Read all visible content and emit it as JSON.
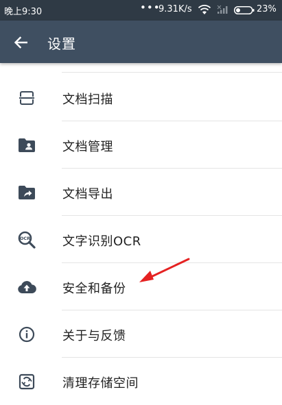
{
  "status_bar": {
    "time": "晚上9:30",
    "dots": "•••",
    "network_speed": "9.31K/s",
    "battery_percent": "23%"
  },
  "app_bar": {
    "back_icon": "arrow-left-icon",
    "title": "设置"
  },
  "settings": {
    "items": [
      {
        "label": "文档扫描",
        "icon": "scan-icon"
      },
      {
        "label": "文档管理",
        "icon": "folder-user-icon"
      },
      {
        "label": "文档导出",
        "icon": "folder-export-icon"
      },
      {
        "label": "文字识别OCR",
        "icon": "ocr-search-icon"
      },
      {
        "label": "安全和备份",
        "icon": "cloud-upload-icon"
      },
      {
        "label": "关于与反馈",
        "icon": "info-icon"
      },
      {
        "label": "清理存储空间",
        "icon": "clean-storage-icon"
      }
    ]
  },
  "annotation": {
    "type": "red-arrow",
    "points_to": "安全和备份"
  },
  "colors": {
    "status_bar": "#2f3a45",
    "app_bar": "#3f4f61",
    "icon": "#3d4a59",
    "text": "#222222",
    "divider": "#e4e4e4",
    "arrow": "#e52222"
  }
}
